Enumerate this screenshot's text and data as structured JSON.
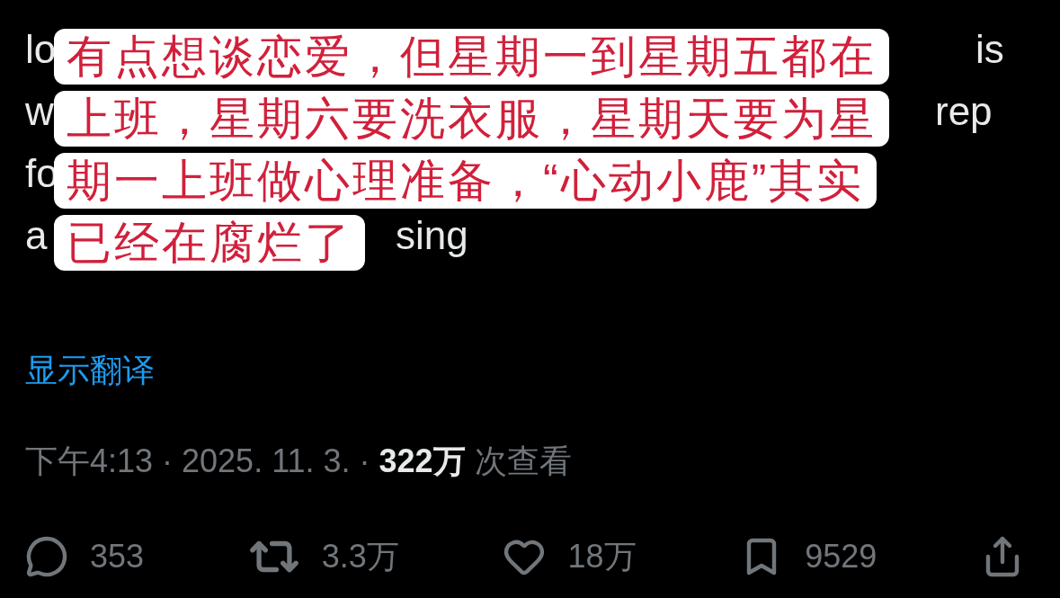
{
  "tweet_text_lines": [
    {
      "start": "lo",
      "end": "is"
    },
    {
      "start": "w",
      "end": "rep"
    },
    {
      "start": "fo"
    },
    {
      "start": "a",
      "end": "sing"
    }
  ],
  "caption": {
    "lines": [
      "有点想谈恋爱，但星期一到星期五都在",
      "上班，星期六要洗衣服，星期天要为星",
      "期一上班做心理准备，“心动小鹿”其实",
      "已经在腐烂了"
    ]
  },
  "translate_link": "显示翻译",
  "meta": {
    "time": "下午4:13 · 2025. 11. 3. · ",
    "views": "322万",
    "views_label": "次查看"
  },
  "actions": [
    {
      "kind": "reply",
      "count": "353"
    },
    {
      "kind": "repost",
      "count": "3.3万"
    },
    {
      "kind": "like",
      "count": "18万"
    },
    {
      "kind": "bookmark",
      "count": "9529"
    },
    {
      "kind": "share"
    }
  ]
}
